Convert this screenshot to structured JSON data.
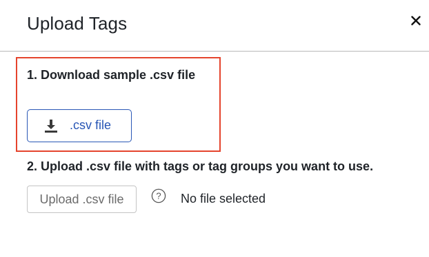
{
  "dialog": {
    "title": "Upload Tags",
    "close_icon": "close-icon"
  },
  "step1": {
    "label": "1. Download sample .csv file",
    "button_label": ".csv file",
    "button_icon": "download-icon",
    "highlight_color": "#e5432c"
  },
  "step2": {
    "label": "2. Upload .csv file with tags or tag groups you want to use.",
    "upload_button_label": "Upload .csv file",
    "help_icon": "help-icon",
    "file_status": "No file selected"
  },
  "colors": {
    "accent": "#2856b5",
    "highlight": "#e5432c",
    "divider": "#b8b8b8"
  }
}
